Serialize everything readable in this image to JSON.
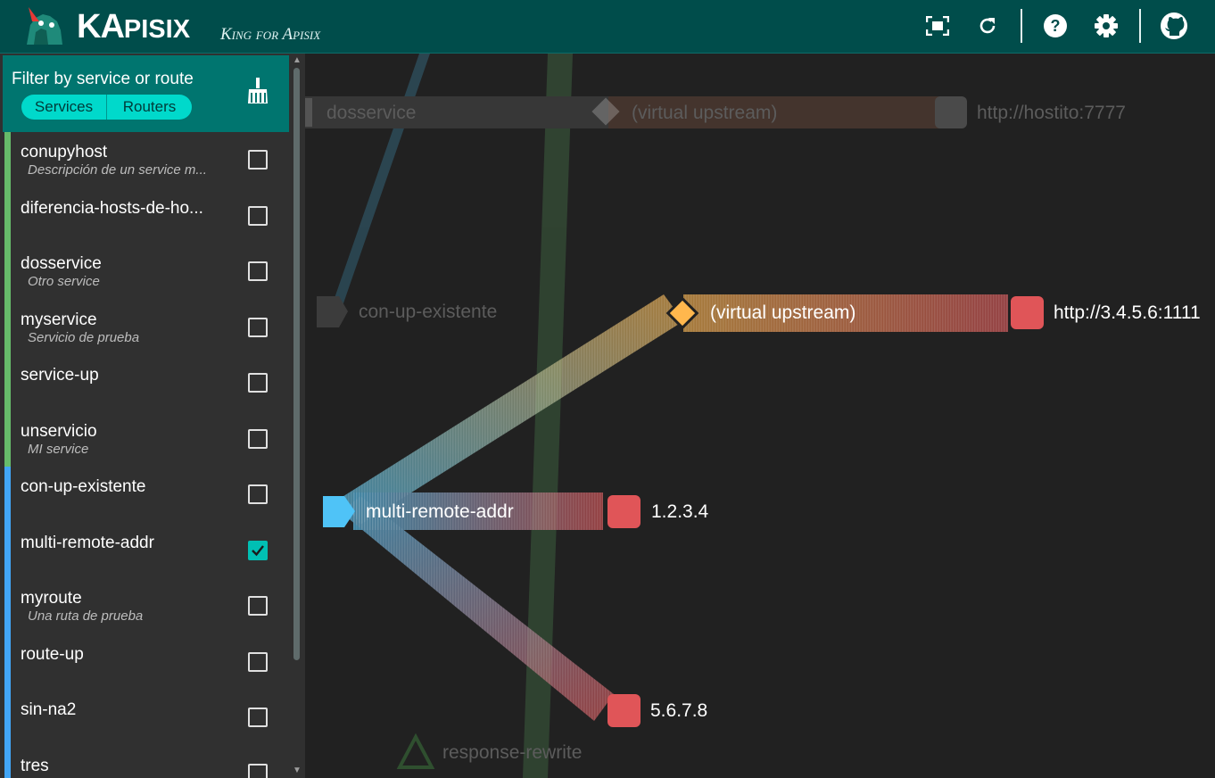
{
  "app": {
    "brand_big": "KA",
    "brand_small": "PISIX",
    "tagline": "King for Apisix"
  },
  "header_icons": [
    "fullscreen-icon",
    "refresh-icon",
    "help-icon",
    "settings-icon",
    "github-icon"
  ],
  "filter": {
    "title": "Filter by service or route",
    "toggle_services": "Services",
    "toggle_routers": "Routers"
  },
  "items": [
    {
      "name": "conupyhost",
      "desc": "Descripción de un service m...",
      "kind": "service",
      "checked": false
    },
    {
      "name": "diferencia-hosts-de-ho...",
      "desc": "",
      "kind": "service",
      "checked": false
    },
    {
      "name": "dosservice",
      "desc": "Otro service",
      "kind": "service",
      "checked": false
    },
    {
      "name": "myservice",
      "desc": "Servicio de prueba",
      "kind": "service",
      "checked": false
    },
    {
      "name": "service-up",
      "desc": "",
      "kind": "service",
      "checked": false
    },
    {
      "name": "unservicio",
      "desc": "MI service",
      "kind": "service",
      "checked": false
    },
    {
      "name": "con-up-existente",
      "desc": "",
      "kind": "route",
      "checked": false
    },
    {
      "name": "multi-remote-addr",
      "desc": "",
      "kind": "route",
      "checked": true
    },
    {
      "name": "myroute",
      "desc": "Una ruta de prueba",
      "kind": "route",
      "checked": false
    },
    {
      "name": "route-up",
      "desc": "",
      "kind": "route",
      "checked": false
    },
    {
      "name": "sin-na2",
      "desc": "",
      "kind": "route",
      "checked": false
    },
    {
      "name": "tres",
      "desc": "",
      "kind": "route",
      "checked": false
    }
  ],
  "colors": {
    "header": "#004d4b",
    "service_bar": "#66bb6a",
    "route_bar": "#42a5f5",
    "upstream": "#ffb74d",
    "target": "#e05558",
    "route_node": "#4fc3f7"
  },
  "graph": {
    "faded": {
      "dosservice": "dosservice",
      "virtual_upstream_top": "(virtual upstream)",
      "hostito": "http://hostito:7777",
      "con_up_existente": "con-up-existente",
      "response_rewrite": "response-rewrite"
    },
    "active": {
      "virtual_upstream": "(virtual upstream)",
      "target_upstream": "http://3.4.5.6:1111",
      "route": "multi-remote-addr",
      "target_a": "1.2.3.4",
      "target_b": "5.6.7.8"
    }
  }
}
